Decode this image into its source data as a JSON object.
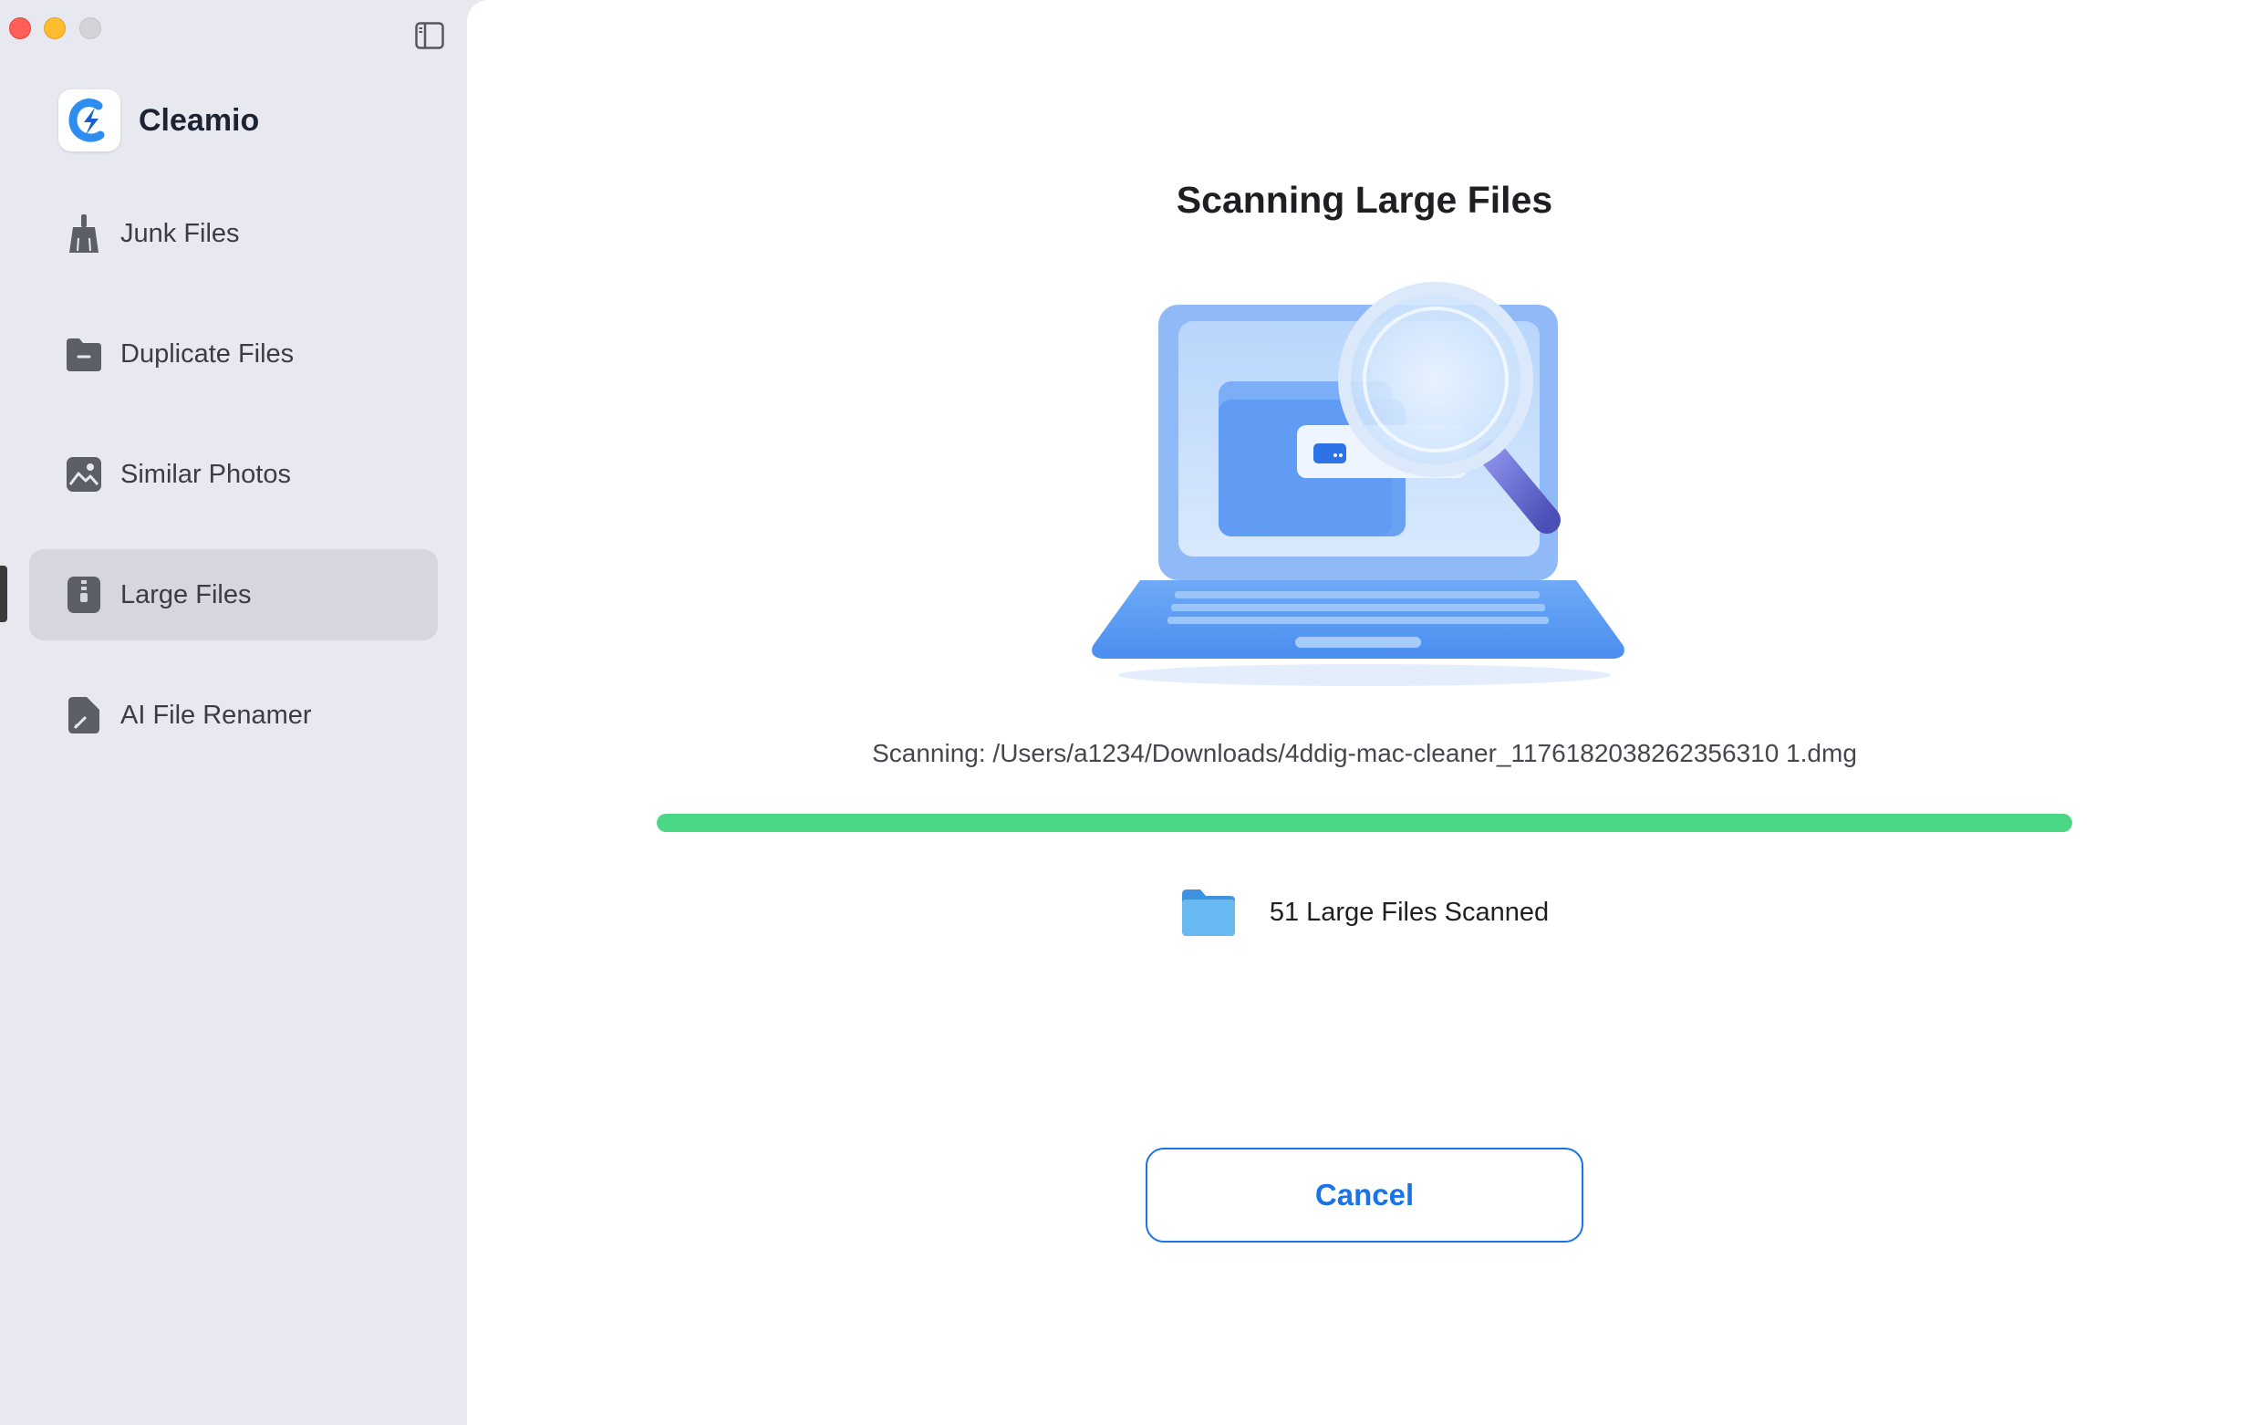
{
  "app": {
    "name": "Cleamio",
    "accent_color": "#1a73e8",
    "progress_color": "#4cd787"
  },
  "window_controls": {
    "close": "close-button",
    "minimize": "minimize-button",
    "zoom": "zoom-button",
    "sidebar_toggle_icon": "sidebar-toggle-icon"
  },
  "sidebar": {
    "items": [
      {
        "label": "Junk Files",
        "icon": "broom-icon",
        "active": false
      },
      {
        "label": "Duplicate Files",
        "icon": "folder-icon",
        "active": false
      },
      {
        "label": "Similar Photos",
        "icon": "photo-icon",
        "active": false
      },
      {
        "label": "Large Files",
        "icon": "zip-file-icon",
        "active": true
      },
      {
        "label": "AI File Renamer",
        "icon": "document-pen-icon",
        "active": false
      }
    ]
  },
  "main": {
    "title": "Scanning Large Files",
    "scan_path": "Scanning: /Users/a1234/Downloads/4ddig-mac-cleaner_1176182038262356310 1.dmg",
    "progress_fraction": 1.0,
    "scanned_count": "51 Large Files Scanned",
    "cancel_label": "Cancel"
  }
}
